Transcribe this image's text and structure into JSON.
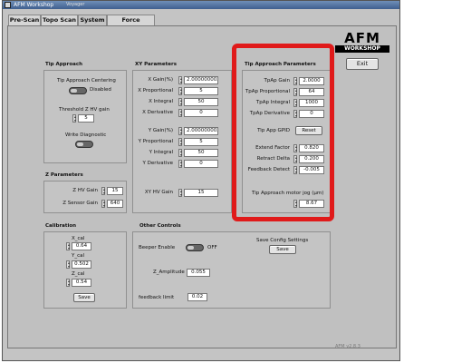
{
  "window": {
    "title": "AFM Workshop",
    "subtitle": "Voyager"
  },
  "tabs": [
    "Pre-Scan",
    "Topo Scan",
    "System",
    "Force Distance"
  ],
  "logo": {
    "line1": "AFM",
    "line2": "WORKSHOP"
  },
  "exit_label": "Exit",
  "tip_approach": {
    "title": "Tip Approach",
    "centering_label": "Tip Approach Centering",
    "centering_state": "Disabled",
    "threshold_label": "Threshold Z HV gain",
    "threshold_value": "5",
    "write_diag_label": "Write Diagnostic"
  },
  "xy": {
    "title": "XY Parameters",
    "rows": [
      {
        "label": "X Gain(%)",
        "value": "2.000000003"
      },
      {
        "label": "X Proportional",
        "value": "5"
      },
      {
        "label": "X Integral",
        "value": "50"
      },
      {
        "label": "X Derivative",
        "value": "0"
      },
      {
        "label": "Y Gain(%)",
        "value": "2.000000003"
      },
      {
        "label": "Y Proportional",
        "value": "5"
      },
      {
        "label": "Y Integral",
        "value": "50"
      },
      {
        "label": "Y Derivative",
        "value": "0"
      }
    ],
    "hv_label": "XY HV Gain",
    "hv_value": "15"
  },
  "tip_params": {
    "title": "Tip Approach Parameters",
    "rows": [
      {
        "label": "TpAp Gain",
        "value": "2.0000"
      },
      {
        "label": "TpAp Proportional",
        "value": "64"
      },
      {
        "label": "TpAp Integral",
        "value": "1000"
      },
      {
        "label": "TpAp Derivative",
        "value": "0"
      }
    ],
    "gpid_label": "Tip App GPID",
    "reset_label": "Reset",
    "rows2": [
      {
        "label": "Extend Factor",
        "value": "0.820"
      },
      {
        "label": "Retract Delta",
        "value": "0.200"
      },
      {
        "label": "Feedback Detect",
        "value": "-0.005"
      }
    ],
    "jog_label": "Tip Approach motor jog (μm)",
    "jog_value": "8.67"
  },
  "z": {
    "title": "Z Parameters",
    "hv_label": "Z HV Gain",
    "hv_value": "15",
    "sensor_label": "Z Sensor Gain",
    "sensor_value": "640"
  },
  "calibration": {
    "title": "Calibration",
    "rows": [
      {
        "label": "X_cal",
        "value": "0.64"
      },
      {
        "label": "Y_cal",
        "value": "0.502"
      },
      {
        "label": "Z_cal",
        "value": "0.54"
      }
    ],
    "save_label": "Save"
  },
  "other": {
    "title": "Other Controls",
    "beeper_label": "Beeper Enable",
    "beeper_state": "OFF",
    "save_config_label": "Save Config Settings",
    "save_label": "Save",
    "zamp_label": "Z_Amplitude",
    "zamp_value": "0.055",
    "feedback_label": "feedback limit",
    "feedback_value": "0.02"
  },
  "version": "AFM v2.8.3",
  "colors": {
    "highlight": "#e01a1a",
    "window_bg": "#c4c4c4"
  }
}
